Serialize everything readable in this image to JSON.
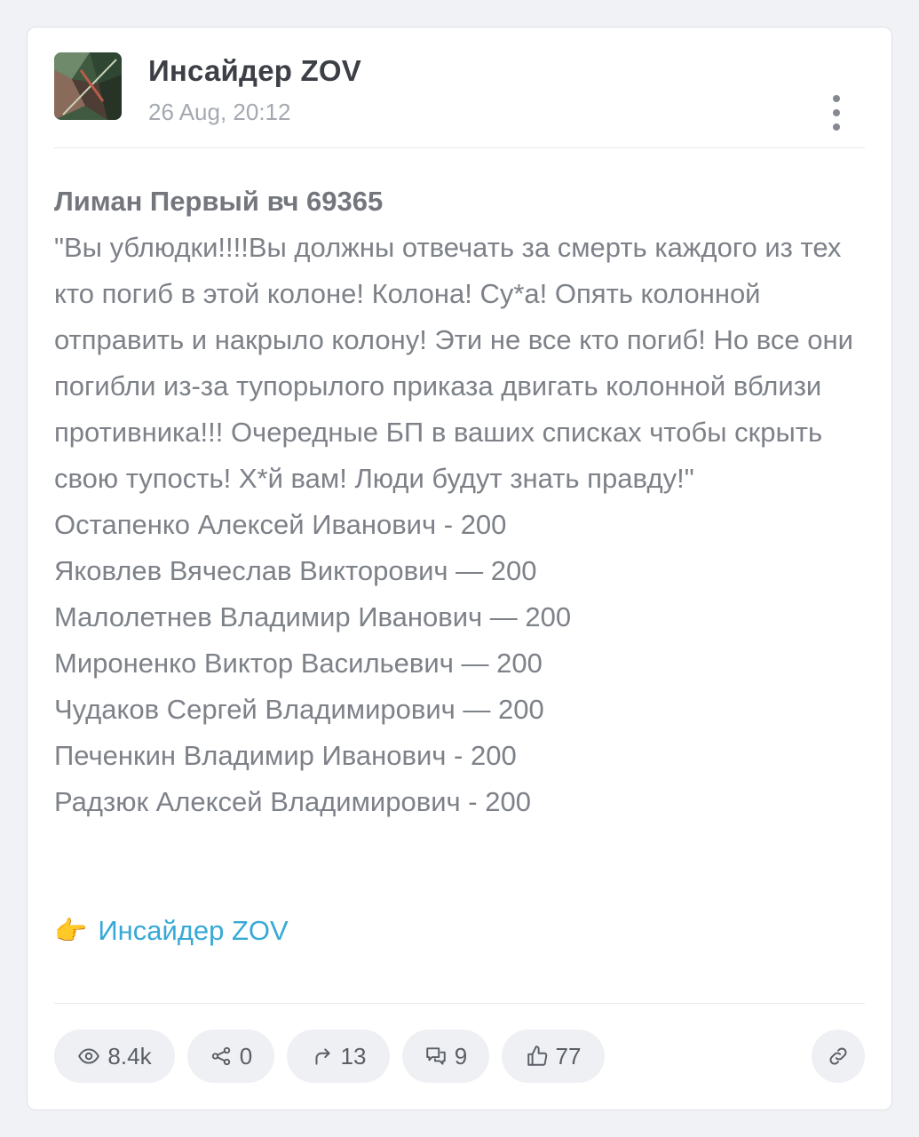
{
  "post": {
    "channel_name": "Инсайдер ZOV",
    "date": "26 Aug, 20:12",
    "title": "Лиман Первый вч 69365",
    "quote": "\"Вы ублюдки!!!!Вы должны отвечать за смерть каждого из тех кто погиб в этой колоне! Колона! Су*а! Опять колонной отправить и накрыло колону! Эти не все кто погиб! Но все они погибли из-за тупорылого приказа двигать колонной вблизи противника!!! Очередные БП в ваших списках чтобы скрыть свою тупость! Х*й вам! Люди будут знать правду!\"",
    "names": [
      "Остапенко Алексей Иванович - 200",
      "Яковлев Вячеслав Викторович — 200",
      "Малолетнев Владимир Иванович — 200",
      "Мироненко Виктор Васильевич — 200",
      "Чудаков Сергей Владимирович — 200",
      "Печенкин Владимир Иванович - 200",
      "Радзюк Алексей Владимирович - 200"
    ],
    "footer_emoji": "👉",
    "footer_link": "Инсайдер ZOV"
  },
  "stats": {
    "views": "8.4k",
    "shares": "0",
    "forwards": "13",
    "comments": "9",
    "reactions": "77"
  },
  "icons": {
    "menu": "more-vertical-icon",
    "views": "eye-icon",
    "shares": "share-icon",
    "forwards": "forward-arrow-icon",
    "comments": "comments-icon",
    "reactions": "thumbs-up-icon",
    "link": "link-icon"
  },
  "colors": {
    "background": "#f1f2f5",
    "card": "#ffffff",
    "link": "#36a9d6",
    "text": "#7d8188",
    "pill": "#eff0f3"
  }
}
